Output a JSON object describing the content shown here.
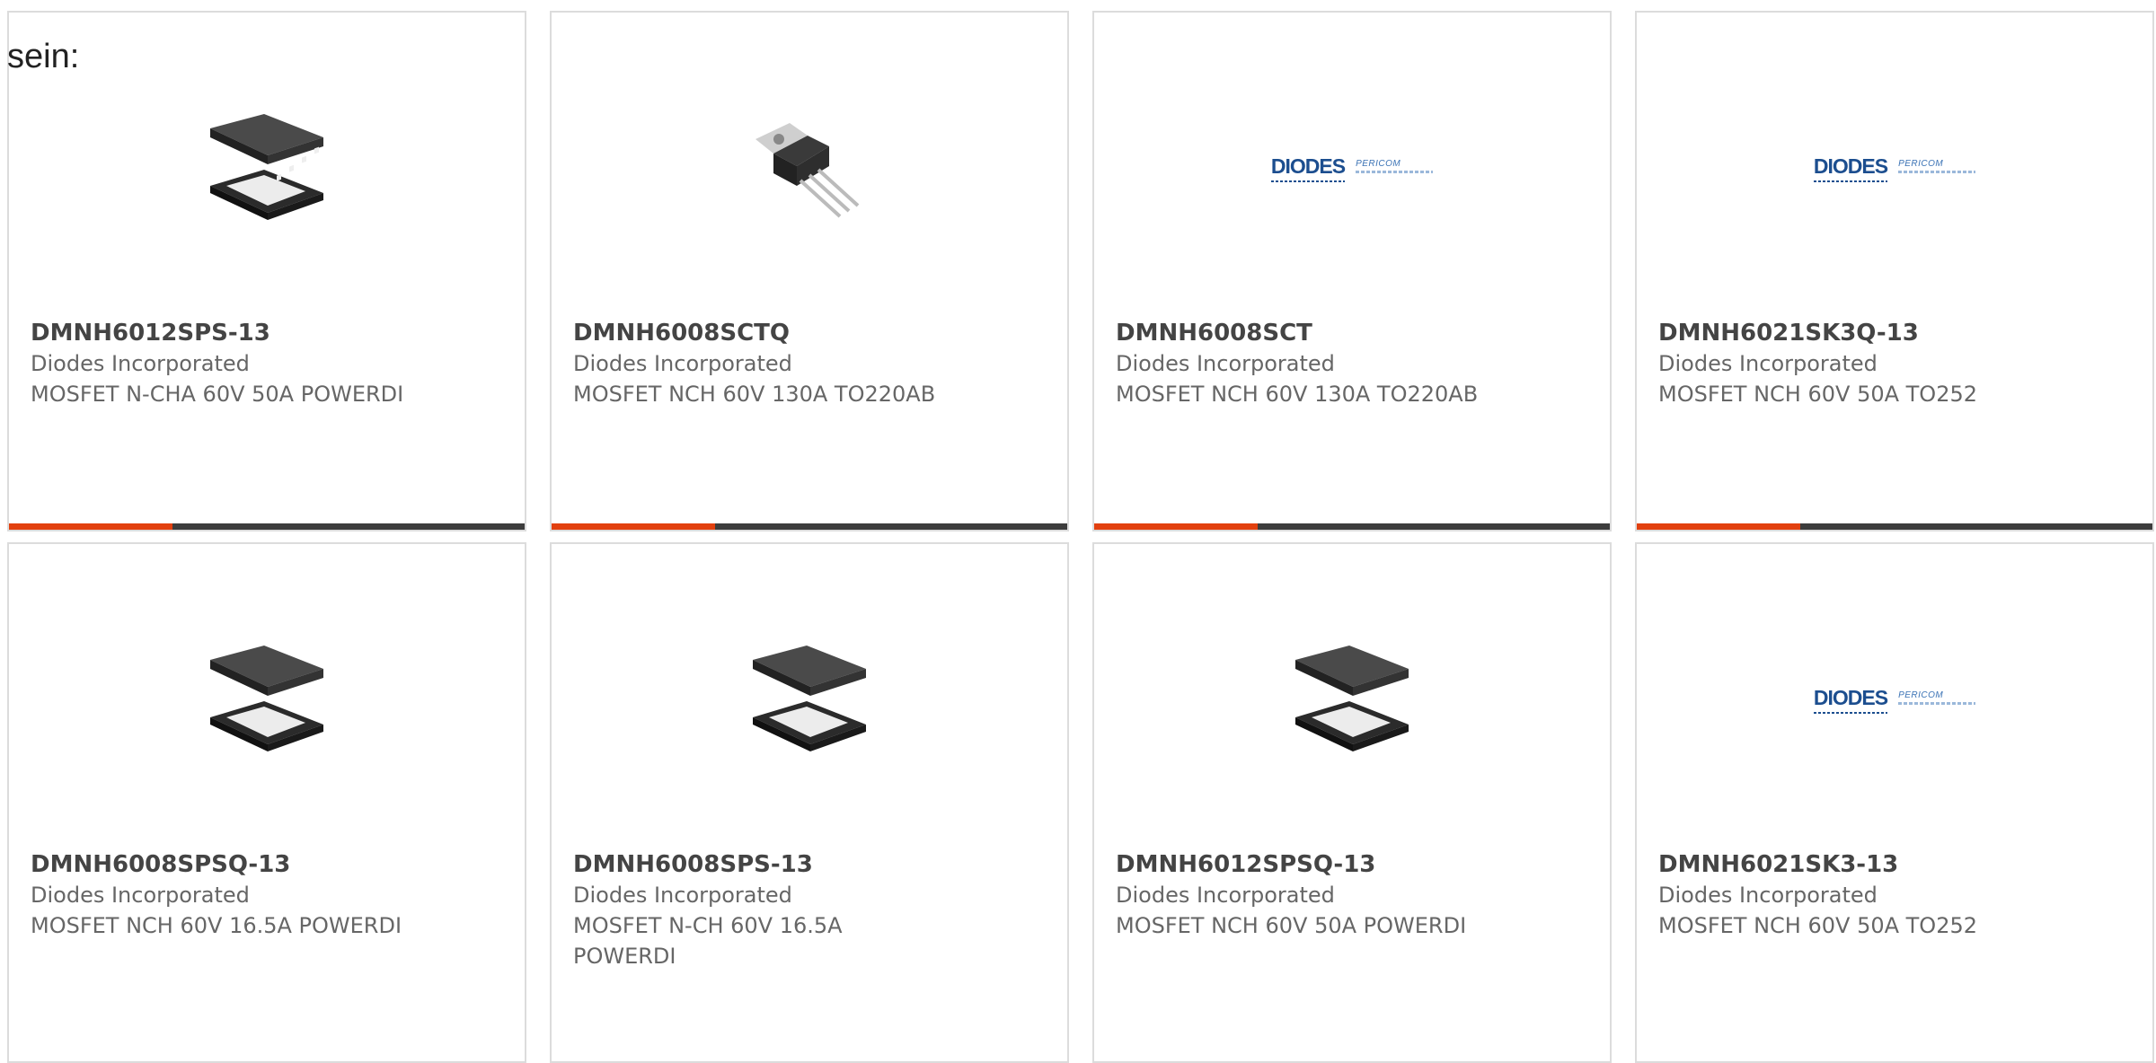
{
  "intro_text": "sein:",
  "products": [
    {
      "part_number": "DMNH6012SPS-13",
      "manufacturer": "Diodes Incorporated",
      "description": "MOSFET N-CHA 60V 50A POWERDI",
      "image": "powerdi-package"
    },
    {
      "part_number": "DMNH6008SCTQ",
      "manufacturer": "Diodes Incorporated",
      "description": "MOSFET NCH 60V 130A TO220AB",
      "image": "to220-package"
    },
    {
      "part_number": "DMNH6008SCT",
      "manufacturer": "Diodes Incorporated",
      "description": "MOSFET NCH 60V 130A TO220AB",
      "image": "diodes-pericom-logo"
    },
    {
      "part_number": "DMNH6021SK3Q-13",
      "manufacturer": "Diodes Incorporated",
      "description": "MOSFET NCH 60V 50A TO252",
      "image": "diodes-pericom-logo"
    },
    {
      "part_number": "DMNH6008SPSQ-13",
      "manufacturer": "Diodes Incorporated",
      "description": "MOSFET NCH 60V 16.5A POWERDI",
      "image": "powerdi-package"
    },
    {
      "part_number": "DMNH6008SPS-13",
      "manufacturer": "Diodes Incorporated",
      "description": "MOSFET N-CH 60V 16.5A POWERDI",
      "image": "powerdi-package"
    },
    {
      "part_number": "DMNH6012SPSQ-13",
      "manufacturer": "Diodes Incorporated",
      "description": "MOSFET NCH 60V 50A POWERDI",
      "image": "powerdi-package"
    },
    {
      "part_number": "DMNH6021SK3-13",
      "manufacturer": "Diodes Incorporated",
      "description": "MOSFET NCH 60V 50A TO252",
      "image": "diodes-pericom-logo"
    }
  ],
  "logo": {
    "main": "DIODES",
    "sub": "PERICOM"
  },
  "colors": {
    "accent": "#e2400f",
    "bar": "#3d3d3d",
    "border": "#dcdcdc",
    "title_text": "#444444",
    "body_text": "#666666"
  }
}
